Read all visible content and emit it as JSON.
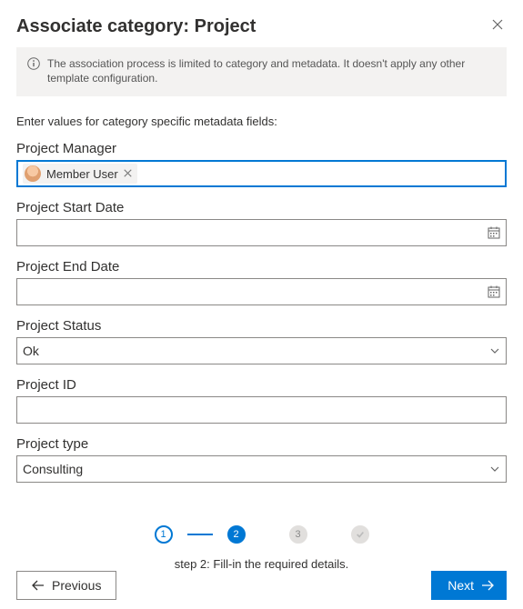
{
  "header": {
    "title": "Associate category: Project"
  },
  "infobar": {
    "text": "The association process is limited to category and metadata. It doesn't apply any other template configuration."
  },
  "instruction": "Enter values for category specific metadata fields:",
  "fields": {
    "project_manager": {
      "label": "Project Manager",
      "chip_name": "Member User"
    },
    "project_start_date": {
      "label": "Project Start Date",
      "value": ""
    },
    "project_end_date": {
      "label": "Project End Date",
      "value": ""
    },
    "project_status": {
      "label": "Project Status",
      "selected": "Ok"
    },
    "project_id": {
      "label": "Project ID",
      "value": ""
    },
    "project_type": {
      "label": "Project type",
      "selected": "Consulting"
    }
  },
  "stepper": {
    "step1_num": "1",
    "step2_num": "2",
    "step3_num": "3",
    "caption": "step 2: Fill-in the required details."
  },
  "footer": {
    "previous": "Previous",
    "next": "Next"
  }
}
